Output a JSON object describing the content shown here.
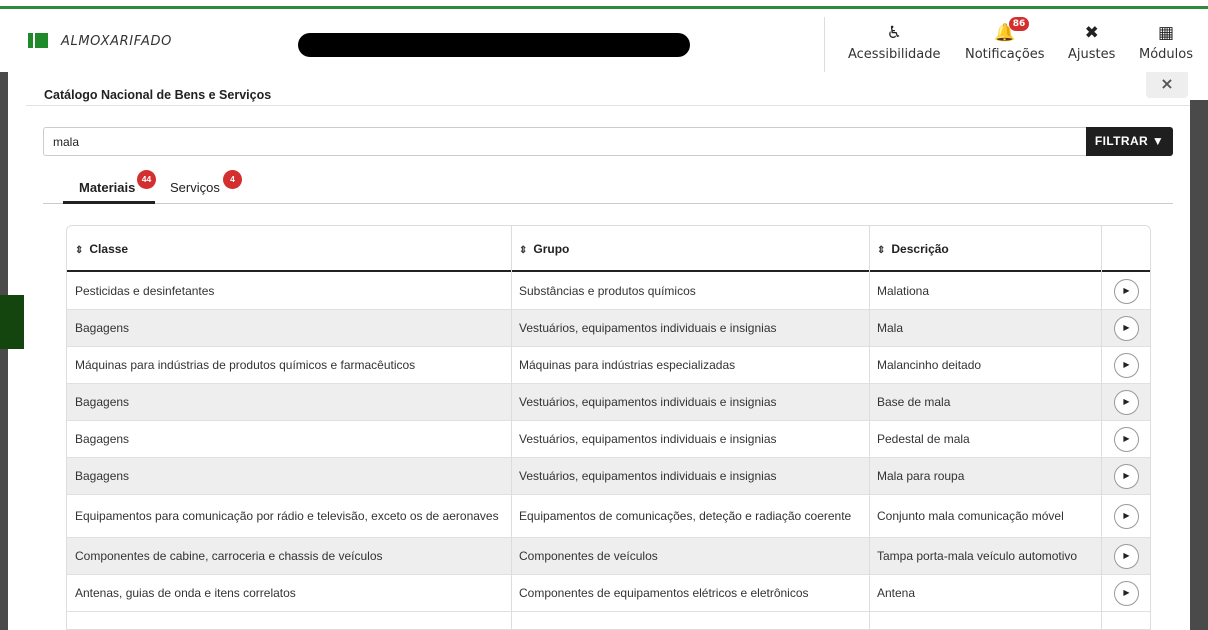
{
  "app": {
    "title": "ALMOXARIFADO"
  },
  "header": {
    "accessibility": {
      "label": "Acessibilidade",
      "icon": "wheelchair-icon"
    },
    "notifications": {
      "label": "Notificações",
      "icon": "bell-icon",
      "count": "86"
    },
    "settings": {
      "label": "Ajustes",
      "icon": "tools-icon"
    },
    "modules": {
      "label": "Módulos",
      "icon": "grid-icon"
    }
  },
  "modal": {
    "title": "Catálogo Nacional de Bens e Serviços",
    "close_label": "×",
    "search": {
      "value": "mala",
      "placeholder": ""
    },
    "filter_label": "FILTRAR",
    "tabs": [
      {
        "label": "Materiais",
        "count": "44"
      },
      {
        "label": "Serviços",
        "count": "4"
      }
    ],
    "table": {
      "headers": [
        "Classe",
        "Grupo",
        "Descrição"
      ],
      "rows": [
        [
          "Pesticidas e desinfetantes",
          "Substâncias e produtos químicos",
          "Malationa"
        ],
        [
          "Bagagens",
          "Vestuários, equipamentos individuais e insignias",
          "Mala"
        ],
        [
          "Máquinas para indústrias de produtos químicos e farmacêuticos",
          "Máquinas para indústrias especializadas",
          "Malancinho deitado"
        ],
        [
          "Bagagens",
          "Vestuários, equipamentos individuais e insignias",
          "Base de mala"
        ],
        [
          "Bagagens",
          "Vestuários, equipamentos individuais e insignias",
          "Pedestal de mala"
        ],
        [
          "Bagagens",
          "Vestuários, equipamentos individuais e insignias",
          "Mala para roupa"
        ],
        [
          "Equipamentos para comunicação por rádio e televisão, exceto os de aeronaves",
          "Equipamentos de comunicações, deteção e radiação coerente",
          "Conjunto mala comunicação móvel"
        ],
        [
          "Componentes de cabine, carroceria e chassis de veículos",
          "Componentes de veículos",
          "Tampa porta-mala veículo automotivo"
        ],
        [
          "Antenas, guias de onda e itens correlatos",
          "Componentes de equipamentos elétricos e eletrônicos",
          "Antena"
        ]
      ]
    }
  },
  "colors": {
    "brand_green": "#1e8a2a",
    "badge_red": "#d32f2f",
    "dark_button": "#1f1f1f"
  }
}
